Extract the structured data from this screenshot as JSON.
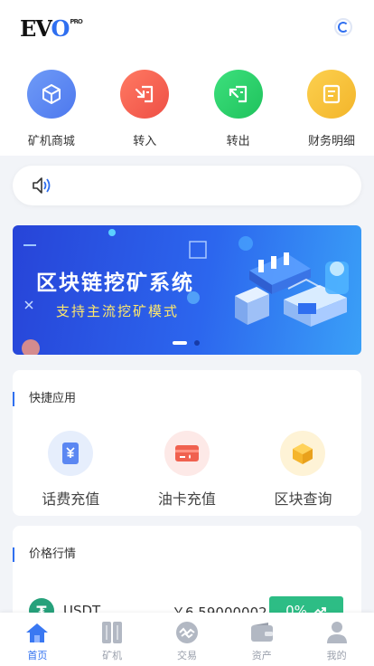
{
  "header": {
    "logo_main": "EV",
    "logo_o": "O",
    "logo_sup": "PRO"
  },
  "quick_actions": [
    {
      "label": "矿机商城",
      "icon": "cube-icon",
      "color": "#5b87f2"
    },
    {
      "label": "转入",
      "icon": "transfer-in-icon",
      "color": "#f2604f"
    },
    {
      "label": "转出",
      "icon": "transfer-out-icon",
      "color": "#2ed46a"
    },
    {
      "label": "财务明细",
      "icon": "ledger-icon",
      "color": "#f7c63a"
    }
  ],
  "banner": {
    "title": "区块链挖矿系统",
    "subtitle": "支持主流挖矿模式"
  },
  "apps_section": {
    "title": "快捷应用",
    "items": [
      {
        "label": "话费充值",
        "icon": "yuan-phone-icon"
      },
      {
        "label": "油卡充值",
        "icon": "fuel-card-icon"
      },
      {
        "label": "区块查询",
        "icon": "block-cube-icon"
      }
    ]
  },
  "market_section": {
    "title": "价格行情",
    "rows": [
      {
        "symbol": "USDT",
        "price": "￥6.59000002",
        "change": "0%"
      }
    ]
  },
  "tabbar": [
    {
      "label": "首页",
      "icon": "home-icon",
      "active": true
    },
    {
      "label": "矿机",
      "icon": "miner-icon",
      "active": false
    },
    {
      "label": "交易",
      "icon": "trade-icon",
      "active": false
    },
    {
      "label": "资产",
      "icon": "wallet-icon",
      "active": false
    },
    {
      "label": "我的",
      "icon": "user-icon",
      "active": false
    }
  ],
  "colors": {
    "accent": "#2f6ff0",
    "up": "#2dbd85",
    "usdt": "#26a17b"
  }
}
